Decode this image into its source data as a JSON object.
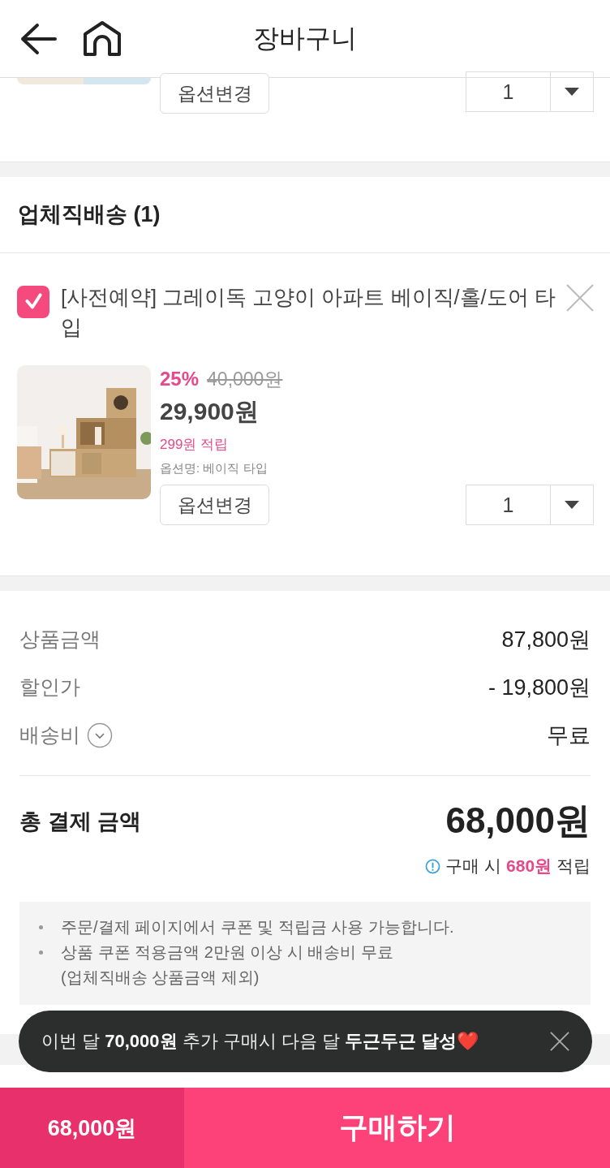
{
  "header": {
    "title": "장바구니"
  },
  "partial_item": {
    "option_button": "옵션변경",
    "quantity": "1"
  },
  "group": {
    "title": "업체직배송 (1)",
    "items": [
      {
        "checked": true,
        "name": "[사전예약] 그레이독 고양이 아파트 베이직/홀/도어 타입",
        "discount": "25%",
        "original_price": "40,000원",
        "price": "29,900원",
        "points": "299원 적립",
        "option": "옵션명: 베이직 타입",
        "option_button": "옵션변경",
        "quantity": "1"
      }
    ]
  },
  "summary": {
    "rows": [
      {
        "label": "상품금액",
        "value": "87,800원",
        "info": false
      },
      {
        "label": "할인가",
        "value": "- 19,800원",
        "info": false
      },
      {
        "label": "배송비",
        "value": "무료",
        "info": true
      }
    ],
    "total_label": "총 결제 금액",
    "total": "68,000원",
    "points_note": "구매 시 **680원** 적립"
  },
  "notes": [
    "주문/결제 페이지에서 쿠폰 및 적립금 사용 가능합니다.",
    "상품 쿠폰 적용금액 2만원 이상 시 배송비 무료\n(업체직배송 상품금액 제외)"
  ],
  "toast": {
    "text": "이번 달 **70,000원** 추가 구매시 다음 달 **두근두근 달성**❤️"
  },
  "bottom_bar": {
    "total": "68,000원",
    "buy_button": "구매하기"
  }
}
